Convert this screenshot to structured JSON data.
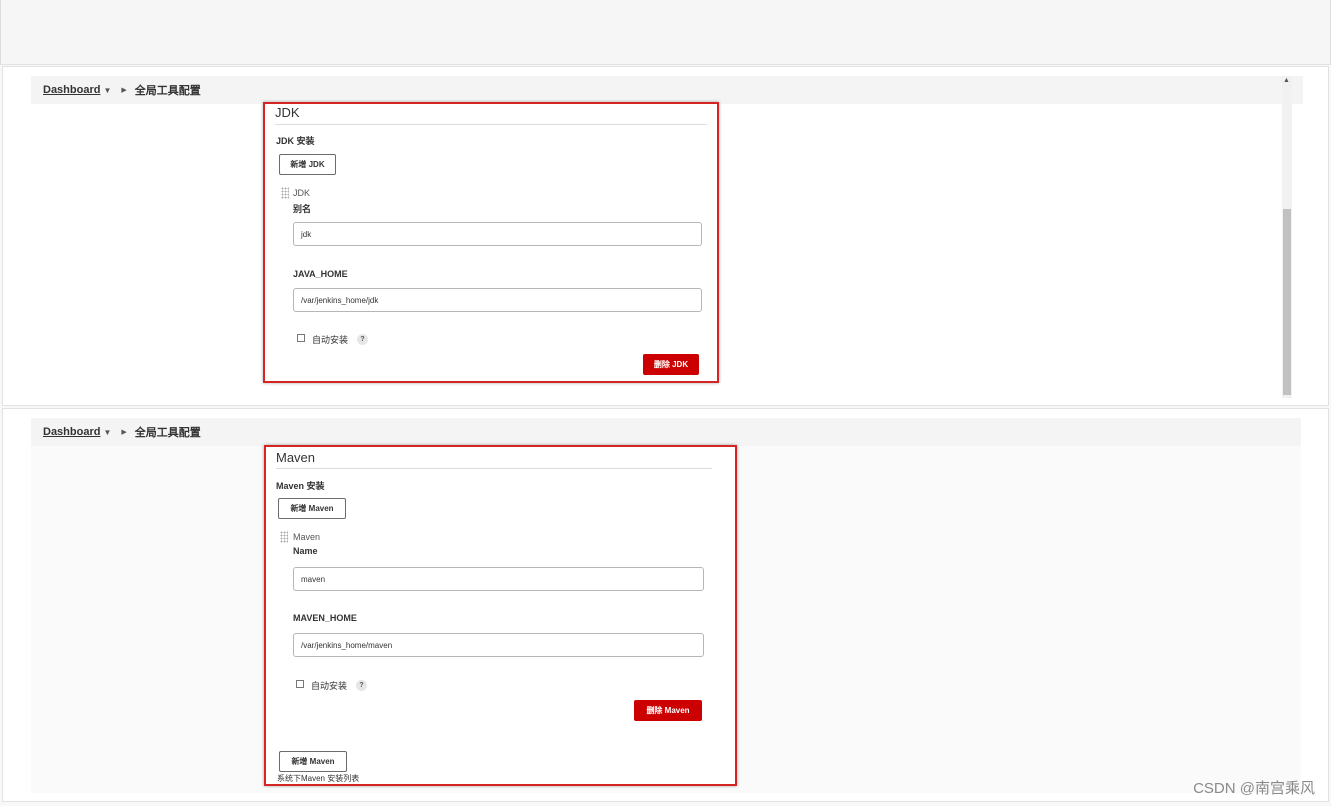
{
  "breadcrumb": {
    "root": "Dashboard",
    "current": "全局工具配置"
  },
  "jdk": {
    "section_title": "JDK",
    "install_title": "JDK 安装",
    "add_button": "新增 JDK",
    "item_name": "JDK",
    "alias_label": "别名",
    "alias_value": "jdk",
    "home_label": "JAVA_HOME",
    "home_value": "/var/jenkins_home/jdk",
    "auto_install_label": "自动安装",
    "auto_install_checked": false,
    "help_glyph": "?",
    "delete_button": "删除 JDK"
  },
  "maven": {
    "section_title": "Maven",
    "install_title": "Maven 安装",
    "add_button": "新增 Maven",
    "item_name": "Maven",
    "name_label": "Name",
    "name_value": "maven",
    "home_label": "MAVEN_HOME",
    "home_value": "/var/jenkins_home/maven",
    "auto_install_label": "自动安装",
    "auto_install_checked": false,
    "help_glyph": "?",
    "delete_button": "删除 Maven",
    "add_button_bottom": "新增 Maven",
    "list_hint": "系统下Maven 安装列表"
  },
  "watermark": "CSDN @南宫乘风",
  "colors": {
    "highlight_border": "#d42424",
    "danger_button": "#cc0000"
  }
}
